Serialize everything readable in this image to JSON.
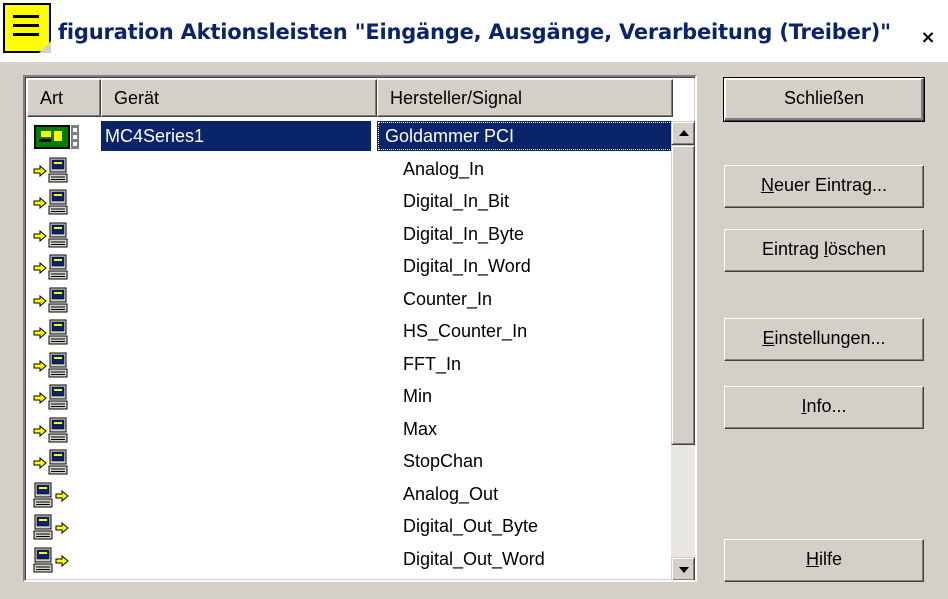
{
  "window": {
    "title": "figuration Aktionsleisten \"Eingänge, Ausgänge, Verarbeitung (Treiber)\"",
    "close_label": "×"
  },
  "list": {
    "columns": [
      "Art",
      "Gerät",
      "Hersteller/Signal"
    ],
    "rows": [
      {
        "type": "device",
        "device": "MC4Series1",
        "signal": "Goldammer PCI",
        "selected": true
      },
      {
        "type": "input",
        "device": "",
        "signal": "Analog_In"
      },
      {
        "type": "input",
        "device": "",
        "signal": "Digital_In_Bit"
      },
      {
        "type": "input",
        "device": "",
        "signal": "Digital_In_Byte"
      },
      {
        "type": "input",
        "device": "",
        "signal": "Digital_In_Word"
      },
      {
        "type": "input",
        "device": "",
        "signal": "Counter_In"
      },
      {
        "type": "input",
        "device": "",
        "signal": "HS_Counter_In"
      },
      {
        "type": "input",
        "device": "",
        "signal": "FFT_In"
      },
      {
        "type": "input",
        "device": "",
        "signal": "Min"
      },
      {
        "type": "input",
        "device": "",
        "signal": "Max"
      },
      {
        "type": "input",
        "device": "",
        "signal": "StopChan"
      },
      {
        "type": "output",
        "device": "",
        "signal": "Analog_Out"
      },
      {
        "type": "output",
        "device": "",
        "signal": "Digital_Out_Byte"
      },
      {
        "type": "output",
        "device": "",
        "signal": "Digital_Out_Word"
      }
    ]
  },
  "buttons": {
    "close": "Schließen",
    "new_entry": {
      "pre": "",
      "u": "N",
      "post": "euer Eintrag..."
    },
    "delete_entry": {
      "pre": "Eintrag ",
      "u": "l",
      "post": "öschen"
    },
    "settings": {
      "pre": "",
      "u": "E",
      "post": "instellungen..."
    },
    "info": {
      "pre": "",
      "u": "I",
      "post": "nfo..."
    },
    "help": {
      "pre": "",
      "u": "H",
      "post": "ilfe"
    }
  },
  "colors": {
    "selection": "#0a246a",
    "face": "#d4d0c8",
    "arrow": "#ffff00",
    "board": "#008000"
  },
  "icons": {
    "input": [
      "arrow-right-icon",
      "computer-icon"
    ],
    "output": [
      "computer-icon",
      "arrow-right-icon"
    ],
    "device": "board-icon"
  }
}
